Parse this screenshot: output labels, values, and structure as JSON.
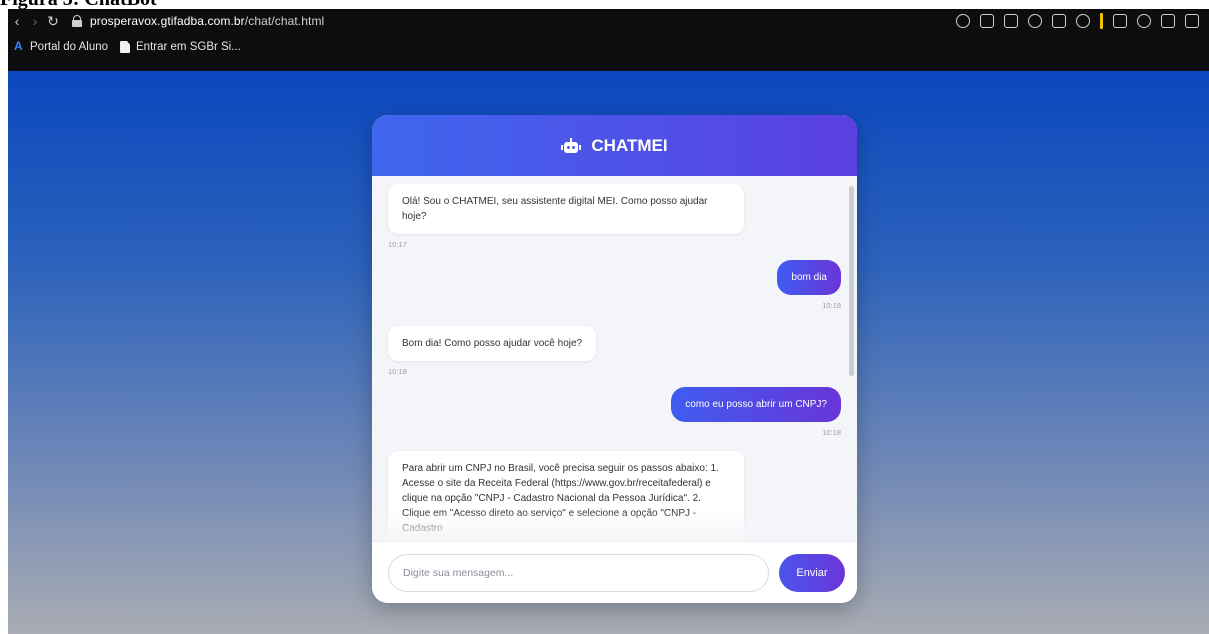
{
  "figure_caption": "Figura 3: ChatBot",
  "browser": {
    "url_prefix": "prosperavox.gtifadba.com.br",
    "url_path": "/chat/chat.html"
  },
  "bookmarks": [
    {
      "label": "Portal do Aluno",
      "icon": "app-logo-icon"
    },
    {
      "label": "Entrar em SGBr Si...",
      "icon": "page-icon"
    }
  ],
  "chat": {
    "title": "CHATMEI",
    "messages": [
      {
        "from": "bot",
        "text": "Olá! Sou o CHATMEI, seu assistente digital MEI. Como posso ajudar hoje?",
        "time": "10:17"
      },
      {
        "from": "user",
        "text": "bom dia",
        "time": "10:18"
      },
      {
        "from": "bot",
        "text": "Bom dia! Como posso ajudar você hoje?",
        "time": "10:18"
      },
      {
        "from": "user",
        "text": "como eu posso abrir um CNPJ?",
        "time": "10:18"
      },
      {
        "from": "bot",
        "text": "Para abrir um CNPJ no Brasil, você precisa seguir os passos abaixo: 1. Acesse o site da Receita Federal (https://www.gov.br/receitafederal) e clique na opção \"CNPJ - Cadastro Nacional da Pessoa Jurídica\". 2. Clique em \"Acesso direto ao serviço\" e selecione a opção \"CNPJ - Cadastro",
        "time": ""
      }
    ],
    "input_placeholder": "Digite sua mensagem...",
    "send_label": "Enviar"
  },
  "colors": {
    "header_start": "#3f67ee",
    "header_end": "#5b3fe0",
    "accent": "#5b3fe0"
  }
}
